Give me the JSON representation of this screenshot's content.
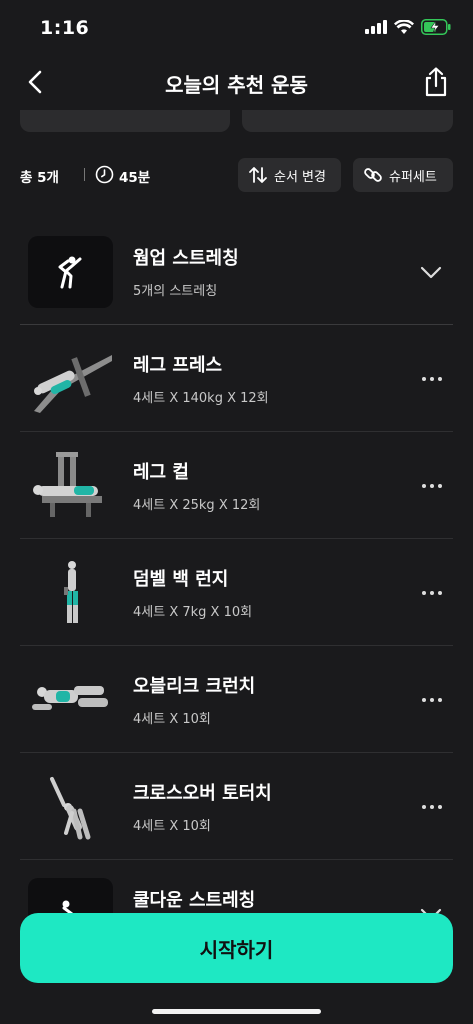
{
  "status": {
    "time": "1:16"
  },
  "header": {
    "title": "오늘의 추천 운동"
  },
  "summary": {
    "count": "총 5개",
    "duration": "45분",
    "order_label": "순서 변경",
    "superset_label": "슈퍼세트"
  },
  "warmup": {
    "name": "웜업 스트레칭",
    "detail": "5개의 스트레칭"
  },
  "exercises": [
    {
      "name": "레그 프레스",
      "detail": "4세트 X 140kg X 12회"
    },
    {
      "name": "레그 컬",
      "detail": "4세트 X 25kg X 12회"
    },
    {
      "name": "덤벨 백 런지",
      "detail": "4세트 X 7kg X 10회"
    },
    {
      "name": "오블리크 크런치",
      "detail": "4세트 X 10회"
    },
    {
      "name": "크로스오버 토터치",
      "detail": "4세트 X 10회"
    }
  ],
  "cooldown": {
    "name": "쿨다운 스트레칭"
  },
  "start_button": {
    "label": "시작하기"
  },
  "colors": {
    "accent": "#1ee8c3",
    "background": "#1a1a1c",
    "card": "#2c2c2e",
    "battery": "#34c759"
  }
}
